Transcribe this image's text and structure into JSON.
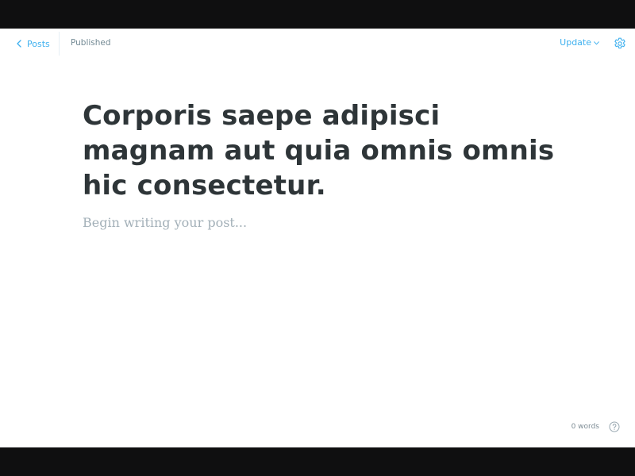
{
  "header": {
    "back_label": "Posts",
    "back_icon": "chevron-left-icon",
    "status": "Published",
    "update_label": "Update",
    "update_icon": "chevron-down-icon",
    "settings_icon": "gear-icon"
  },
  "post": {
    "title": "Corporis saepe adipisci magnam aut quia omnis omnis hic consectetur.",
    "body_placeholder": "Begin writing your post..."
  },
  "footer": {
    "word_count": "0 words",
    "help_icon": "help-circle-icon"
  },
  "colors": {
    "accent": "#3eb0ef",
    "title": "#2e3538",
    "muted": "#738a94",
    "placeholder": "#a3b0b8"
  }
}
